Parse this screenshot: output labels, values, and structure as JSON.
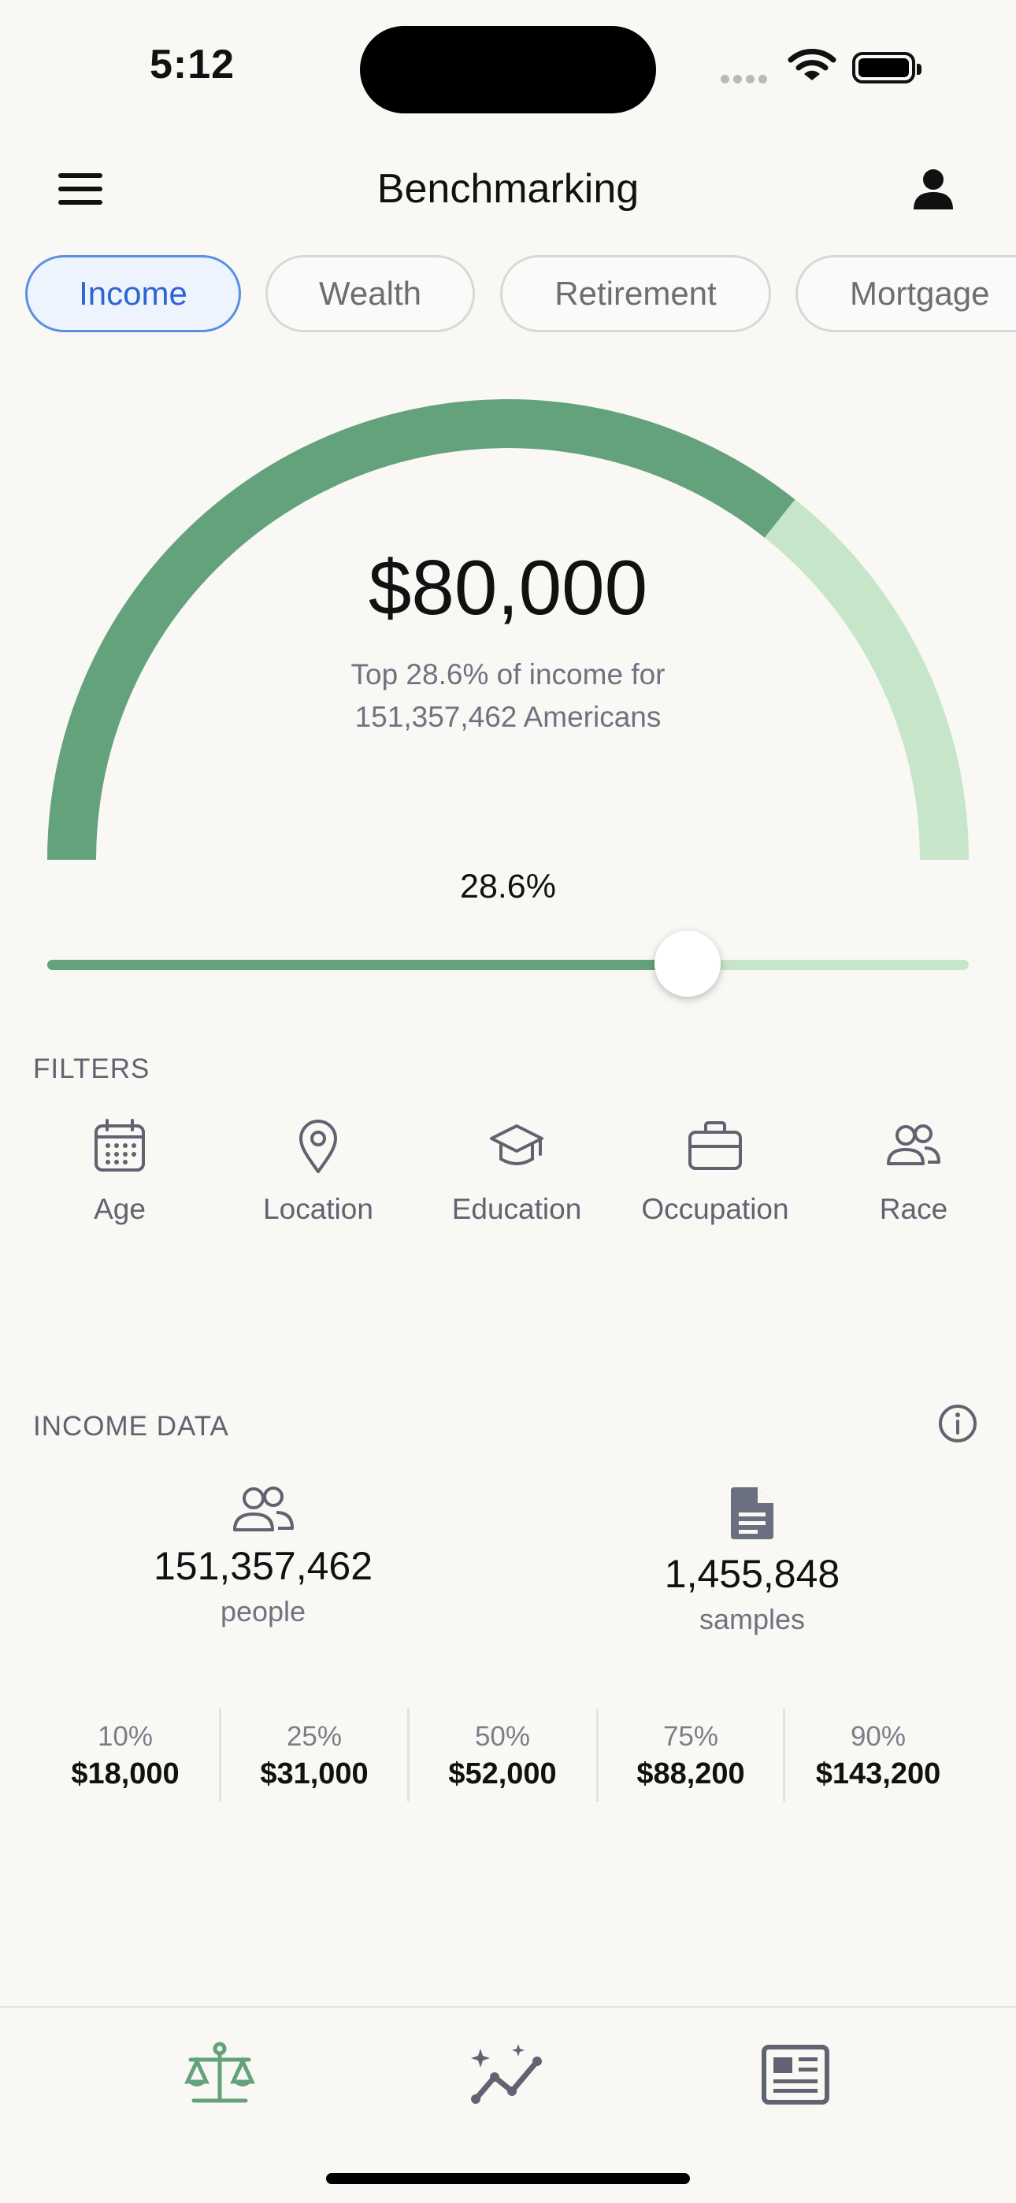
{
  "status_bar": {
    "time": "5:12"
  },
  "header": {
    "title": "Benchmarking"
  },
  "tabs": [
    {
      "label": "Income",
      "active": true
    },
    {
      "label": "Wealth",
      "active": false
    },
    {
      "label": "Retirement",
      "active": false
    },
    {
      "label": "Mortgage",
      "active": false
    }
  ],
  "gauge": {
    "amount": "$80,000",
    "subtitle_line1": "Top 28.6% of income for",
    "subtitle_line2": "151,357,462 Americans",
    "percent_label": "28.6%",
    "fill_fraction": 0.714
  },
  "slider": {
    "value_fraction": 0.695
  },
  "filters": {
    "heading": "FILTERS",
    "items": [
      {
        "label": "Age",
        "icon": "calendar-icon"
      },
      {
        "label": "Location",
        "icon": "location-pin-icon"
      },
      {
        "label": "Education",
        "icon": "graduation-cap-icon"
      },
      {
        "label": "Occupation",
        "icon": "briefcase-icon"
      },
      {
        "label": "Race",
        "icon": "people-icon"
      }
    ]
  },
  "income_data": {
    "heading": "INCOME DATA",
    "people": {
      "value": "151,357,462",
      "unit": "people"
    },
    "samples": {
      "value": "1,455,848",
      "unit": "samples"
    },
    "percentiles": [
      {
        "p": "10%",
        "v": "$18,000"
      },
      {
        "p": "25%",
        "v": "$31,000"
      },
      {
        "p": "50%",
        "v": "$52,000"
      },
      {
        "p": "75%",
        "v": "$88,200"
      },
      {
        "p": "90%",
        "v": "$143,200"
      }
    ]
  },
  "tab_bar": {
    "items": [
      {
        "icon": "scale-icon",
        "active": true
      },
      {
        "icon": "sparkle-chart-icon",
        "active": false
      },
      {
        "icon": "news-icon",
        "active": false
      }
    ]
  },
  "colors": {
    "gauge_dark": "#64a27b",
    "gauge_light": "#c7e6c9",
    "chip_active": "#2b66d1",
    "tab_active": "#64a27b",
    "tab_inactive": "#5f6470"
  }
}
